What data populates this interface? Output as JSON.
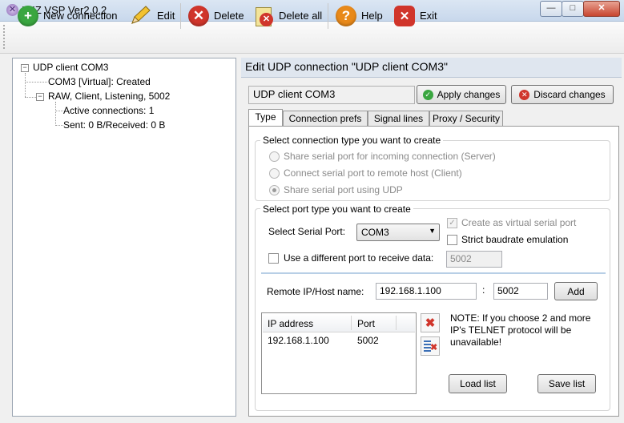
{
  "window": {
    "title": "WIZ VSP Ver2.0.2"
  },
  "toolbar": {
    "new_connection": "New connection",
    "edit": "Edit",
    "delete": "Delete",
    "delete_all": "Delete all",
    "help": "Help",
    "exit": "Exit"
  },
  "tree": {
    "root": "UDP client COM3",
    "child1": "COM3 [Virtual]: Created",
    "child2": "RAW, Client, Listening, 5002",
    "child2a": "Active connections: 1",
    "child2b": "Sent: 0 B/Received: 0 B"
  },
  "panel": {
    "title": "Edit UDP connection \"UDP client COM3\"",
    "name_value": "UDP client COM3",
    "apply": "Apply changes",
    "discard": "Discard changes"
  },
  "tabs": [
    "Type",
    "Connection prefs",
    "Signal lines",
    "Proxy / Security"
  ],
  "type_group": {
    "label": "Select connection type you want to create",
    "options": [
      "Share serial port for incoming connection (Server)",
      "Connect serial port to remote host (Client)",
      "Share serial port using UDP"
    ],
    "selected": 2
  },
  "port_group": {
    "label": "Select port type you want to create",
    "serial_port_label": "Select Serial Port:",
    "serial_port_value": "COM3",
    "virtual_label": "Create as virtual serial port",
    "virtual_checked": true,
    "strict_label": "Strict baudrate emulation",
    "strict_checked": false,
    "diff_port_label": "Use a different port to receive data:",
    "diff_port_checked": false,
    "diff_port_value": "5002"
  },
  "remote": {
    "label": "Remote IP/Host name:",
    "ip": "192.168.1.100",
    "colon": ":",
    "port": "5002",
    "add": "Add"
  },
  "host_list": {
    "columns": [
      "IP address",
      "Port"
    ],
    "rows": [
      {
        "ip": "192.168.1.100",
        "port": "5002"
      }
    ]
  },
  "note": {
    "line1": "NOTE: If you choose 2 and more",
    "line2": "IP's TELNET protocol will be",
    "line3": "unavailable!"
  },
  "buttons": {
    "load_list": "Load list",
    "save_list": "Save list"
  },
  "colors": {
    "accent": "#4a90d9",
    "green": "#3aa640",
    "red": "#d0352b",
    "orange": "#e8891a"
  }
}
